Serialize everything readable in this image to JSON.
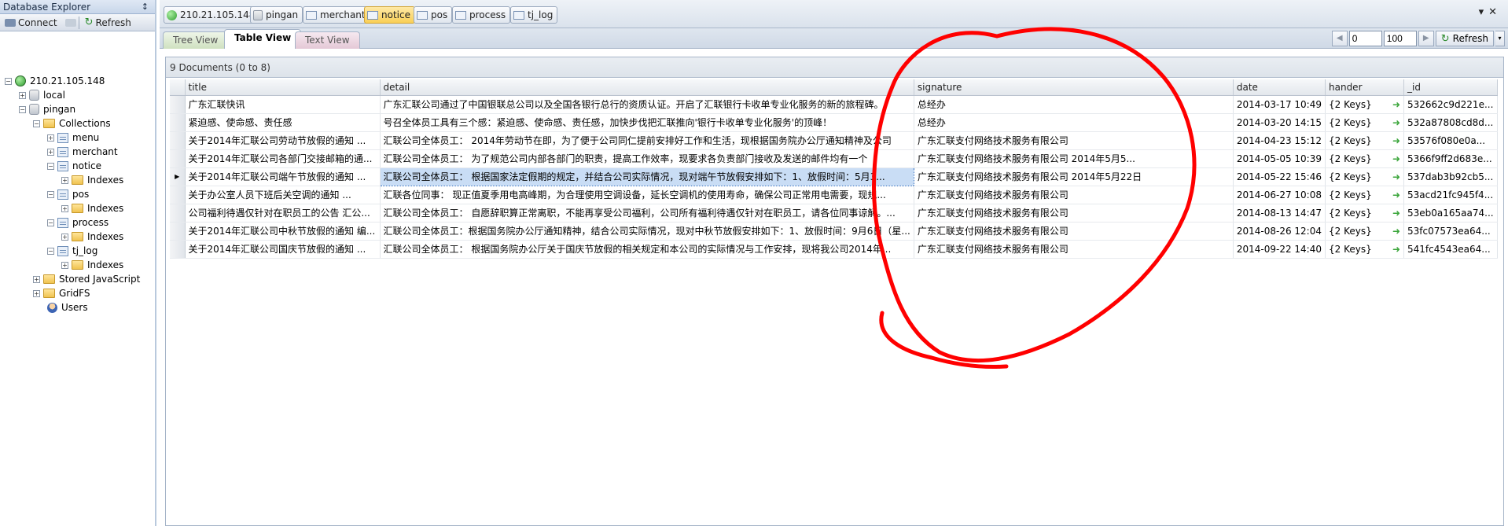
{
  "sidebar": {
    "title": "Database Explorer",
    "toolbar": {
      "connect": "Connect",
      "refresh": "Refresh"
    },
    "tree": {
      "server": "210.21.105.148",
      "local": "local",
      "pingan": "pingan",
      "collections": "Collections",
      "menu": "menu",
      "merchant": "merchant",
      "notice": "notice",
      "indexes": "Indexes",
      "pos": "pos",
      "process": "process",
      "tj_log": "tj_log",
      "stored_js": "Stored JavaScript",
      "gridfs": "GridFS",
      "users": "Users"
    }
  },
  "context_tabs": [
    "210.21.105.148",
    "pingan",
    "merchant",
    "notice",
    "pos",
    "process",
    "tj_log"
  ],
  "active_context_tab": "notice",
  "view_tabs": {
    "tree": "Tree View",
    "table": "Table View",
    "text": "Text View"
  },
  "pager": {
    "skip": "0",
    "limit": "100",
    "refresh": "Refresh"
  },
  "info": "9 Documents (0 to 8)",
  "columns": {
    "title": "title",
    "detail": "detail",
    "signature": "signature",
    "date": "date",
    "hander": "hander",
    "id": "_id"
  },
  "rows": [
    {
      "title": "广东汇联快讯",
      "detail": "广东汇联公司通过了中国银联总公司以及全国各银行总行的资质认证。开启了汇联银行卡收单专业化服务的新的旅程碑。",
      "signature": "总经办",
      "date": "2014-03-17 10:49",
      "hander": "{2 Keys}",
      "id": "532662c9d221e..."
    },
    {
      "title": "紧迫感、使命感、责任感",
      "detail": "号召全体员工具有三个感：紧迫感、使命感、责任感，加快步伐把汇联推向'银行卡收单专业化服务'的顶峰！",
      "signature": "总经办",
      "date": "2014-03-20 14:15",
      "hander": "{2 Keys}",
      "id": "532a87808cd8d..."
    },
    {
      "title": "关于2014年汇联公司劳动节放假的通知         ...",
      "detail": "汇联公司全体员工：     2014年劳动节在即，为了便于公司同仁提前安排好工作和生活，现根据国务院办公厅通知精神及公司",
      "signature": "广东汇联支付网络技术服务有限公司",
      "date": "2014-04-23 15:12",
      "hander": "{2 Keys}",
      "id": "53576f080e0a..."
    },
    {
      "title": "关于2014年汇联公司各部门交接邮箱的通...",
      "detail": "汇联公司全体员工：              为了规范公司内部各部门的职责，提高工作效率，现要求各负责部门接收及发送的邮件均有一个",
      "signature": "广东汇联支付网络技术服务有限公司                              2014年5月5...",
      "date": "2014-05-05 10:39",
      "hander": "{2 Keys}",
      "id": "5366f9ff2d683e..."
    },
    {
      "title": "关于2014年汇联公司端午节放假的通知         ...",
      "detail": "汇联公司全体员工：              根据国家法定假期的规定，并结合公司实际情况，现对端午节放假安排如下：1、放假时间：5月3...",
      "signature": "广东汇联支付网络技术服务有限公司                      2014年5月22日",
      "date": "2014-05-22 15:46",
      "hander": "{2 Keys}",
      "id": "537dab3b92cb5..."
    },
    {
      "title": "关于办公室人员下班后关空调的通知         ...",
      "detail": "汇联各位同事：     现正值夏季用电高峰期，为合理使用空调设备，延长空调机的使用寿命，确保公司正常用电需要，现规...",
      "signature": "广东汇联支付网络技术服务有限公司",
      "date": "2014-06-27 10:08",
      "hander": "{2 Keys}",
      "id": "53acd21fc945f4..."
    },
    {
      "title": "公司福利待遇仅针对在职员工的公告 汇公...",
      "detail": "汇联公司全体员工：      自愿辞职算正常离职，不能再享受公司福利，公司所有福利待遇仅针对在职员工，请各位同事谅解。...",
      "signature": " 广东汇联支付网络技术服务有限公司",
      "date": "2014-08-13 14:47",
      "hander": "{2 Keys}",
      "id": "53eb0a165aa74..."
    },
    {
      "title": "关于2014年汇联公司中秋节放假的通知 编...",
      "detail": "汇联公司全体员工：根据国务院办公厅通知精神，结合公司实际情况，现对中秋节放假安排如下：1、放假时间：9月6日（星...",
      "signature": "广东汇联支付网络技术服务有限公司",
      "date": "2014-08-26 12:04",
      "hander": "{2 Keys}",
      "id": "53fc07573ea64..."
    },
    {
      "title": "关于2014年汇联公司国庆节放假的通知         ...",
      "detail": "汇联公司全体员工：         根据国务院办公厅关于国庆节放假的相关规定和本公司的实际情况与工作安排，现将我公司2014年...",
      "signature": "广东汇联支付网络技术服务有限公司",
      "date": "2014-09-22 14:40",
      "hander": "{2 Keys}",
      "id": "541fc4543ea64..."
    }
  ],
  "selected_row_index": 4,
  "annotation_color": "#ff0000"
}
